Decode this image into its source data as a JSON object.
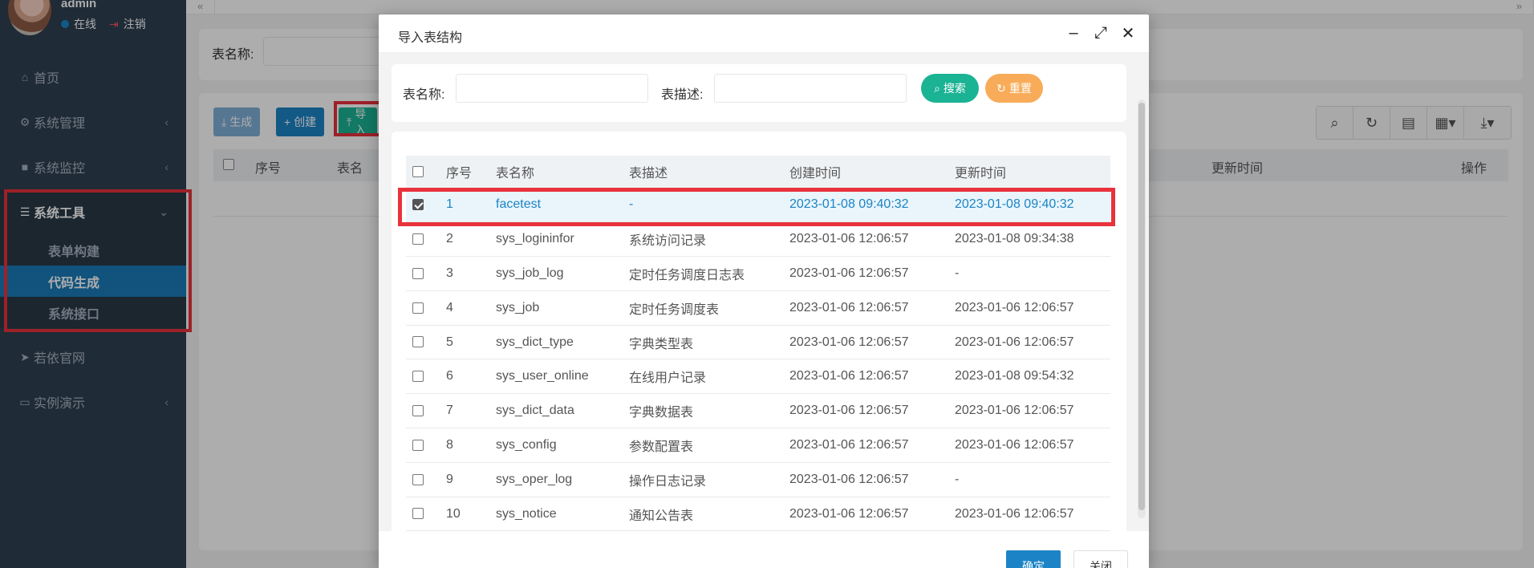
{
  "user": {
    "name": "admin",
    "status": "在线",
    "logout": "注销"
  },
  "nav": {
    "home": "首页",
    "system_mgmt": "系统管理",
    "system_monitor": "系统监控",
    "system_tools": "系统工具",
    "sub": [
      "表单构建",
      "代码生成",
      "系统接口"
    ],
    "ruoyi_site": "若依官网",
    "demo": "实例演示"
  },
  "page": {
    "search_label": "表名称:",
    "btn_generate": "生成",
    "btn_create": "创建",
    "btn_import": "导入",
    "col_seq": "序号",
    "col_name": "表名",
    "col_update": "更新时间",
    "col_action": "操作"
  },
  "modal": {
    "title": "导入表结构",
    "search": {
      "name_label": "表名称:",
      "desc_label": "表描述:",
      "btn_search": "搜索",
      "btn_reset": "重置"
    },
    "columns": [
      "序号",
      "表名称",
      "表描述",
      "创建时间",
      "更新时间"
    ],
    "rows": [
      {
        "seq": "1",
        "name": "facetest",
        "desc": "-",
        "created": "2023-01-08 09:40:32",
        "updated": "2023-01-08 09:40:32",
        "checked": true
      },
      {
        "seq": "2",
        "name": "sys_logininfor",
        "desc": "系统访问记录",
        "created": "2023-01-06 12:06:57",
        "updated": "2023-01-08 09:34:38",
        "checked": false
      },
      {
        "seq": "3",
        "name": "sys_job_log",
        "desc": "定时任务调度日志表",
        "created": "2023-01-06 12:06:57",
        "updated": "-",
        "checked": false
      },
      {
        "seq": "4",
        "name": "sys_job",
        "desc": "定时任务调度表",
        "created": "2023-01-06 12:06:57",
        "updated": "2023-01-06 12:06:57",
        "checked": false
      },
      {
        "seq": "5",
        "name": "sys_dict_type",
        "desc": "字典类型表",
        "created": "2023-01-06 12:06:57",
        "updated": "2023-01-06 12:06:57",
        "checked": false
      },
      {
        "seq": "6",
        "name": "sys_user_online",
        "desc": "在线用户记录",
        "created": "2023-01-06 12:06:57",
        "updated": "2023-01-08 09:54:32",
        "checked": false
      },
      {
        "seq": "7",
        "name": "sys_dict_data",
        "desc": "字典数据表",
        "created": "2023-01-06 12:06:57",
        "updated": "2023-01-06 12:06:57",
        "checked": false
      },
      {
        "seq": "8",
        "name": "sys_config",
        "desc": "参数配置表",
        "created": "2023-01-06 12:06:57",
        "updated": "2023-01-06 12:06:57",
        "checked": false
      },
      {
        "seq": "9",
        "name": "sys_oper_log",
        "desc": "操作日志记录",
        "created": "2023-01-06 12:06:57",
        "updated": "-",
        "checked": false
      },
      {
        "seq": "10",
        "name": "sys_notice",
        "desc": "通知公告表",
        "created": "2023-01-06 12:06:57",
        "updated": "2023-01-06 12:06:57",
        "checked": false
      }
    ],
    "btn_ok": "确定",
    "btn_close": "关闭"
  },
  "colors": {
    "sidebar_bg": "#2f4050",
    "primary": "#1c84c6",
    "success": "#1ab394",
    "warning": "#f8ac59",
    "highlight": "#e8323c"
  }
}
